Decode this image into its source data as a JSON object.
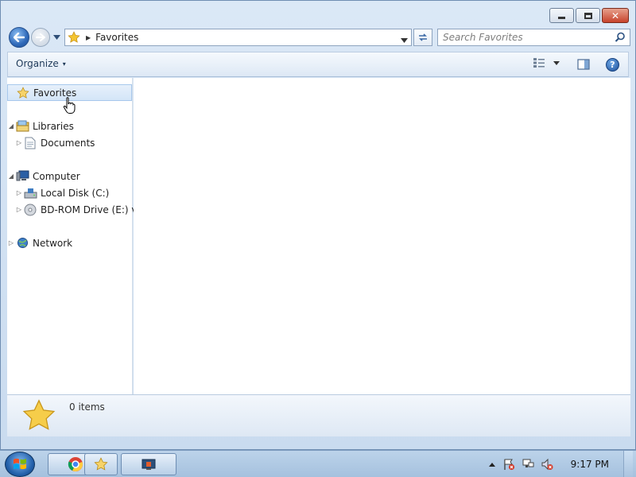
{
  "window": {
    "caption_buttons": [
      "minimize",
      "maximize",
      "close"
    ]
  },
  "nav": {
    "address_location": "Favorites",
    "search_placeholder": "Search Favorites"
  },
  "commandbar": {
    "organize_label": "Organize",
    "caret": "▾"
  },
  "tree": {
    "favorites": "Favorites",
    "libraries": "Libraries",
    "documents": "Documents",
    "computer": "Computer",
    "local_disk": "Local Disk (C:)",
    "bd_rom": "BD-ROM Drive (E:) v",
    "network": "Network"
  },
  "details": {
    "item_count": "0 items"
  },
  "taskbar": {
    "clock": "9:17 PM"
  },
  "colors": {
    "accent": "#2f69b9",
    "star": "#f4c430",
    "selected_bg": "#d4e5f8"
  }
}
